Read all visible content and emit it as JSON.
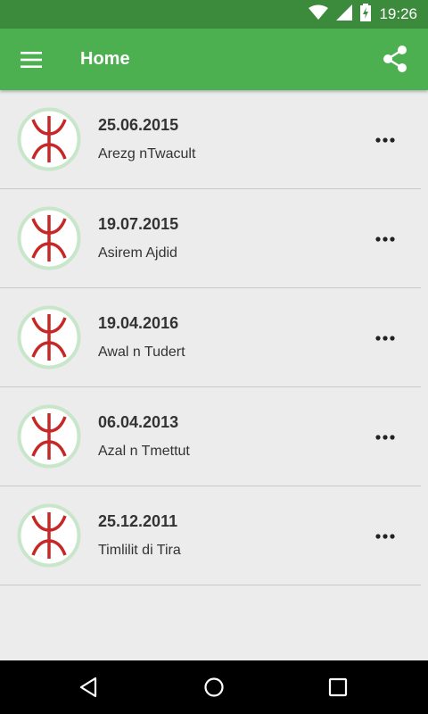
{
  "status_bar": {
    "time": "19:26",
    "icons": [
      "wifi-icon",
      "signal-icon",
      "battery-charging-icon"
    ]
  },
  "app_bar": {
    "title": "Home",
    "menu_icon": "hamburger-menu-icon",
    "share_icon": "share-icon"
  },
  "items": [
    {
      "date": "25.06.2015",
      "name": "Arezg nTwacult"
    },
    {
      "date": "19.07.2015",
      "name": "Asirem Ajdid"
    },
    {
      "date": "19.04.2016",
      "name": "Awal n Tudert"
    },
    {
      "date": "06.04.2013",
      "name": "Azal n Tmettut"
    },
    {
      "date": "25.12.2011",
      "name": "Timlilit di Tira"
    }
  ],
  "item_avatar_icon": "amazigh-yaz-symbol-icon",
  "item_more_icon": "more-horizontal-icon",
  "nav_bar": {
    "icons": [
      "back-icon",
      "home-icon",
      "recents-icon"
    ]
  },
  "colors": {
    "status_bar": "#3c8a3c",
    "app_bar": "#4caf50",
    "background": "#ececec",
    "avatar_ring": "#c8e6c9",
    "symbol": "#c62828"
  }
}
